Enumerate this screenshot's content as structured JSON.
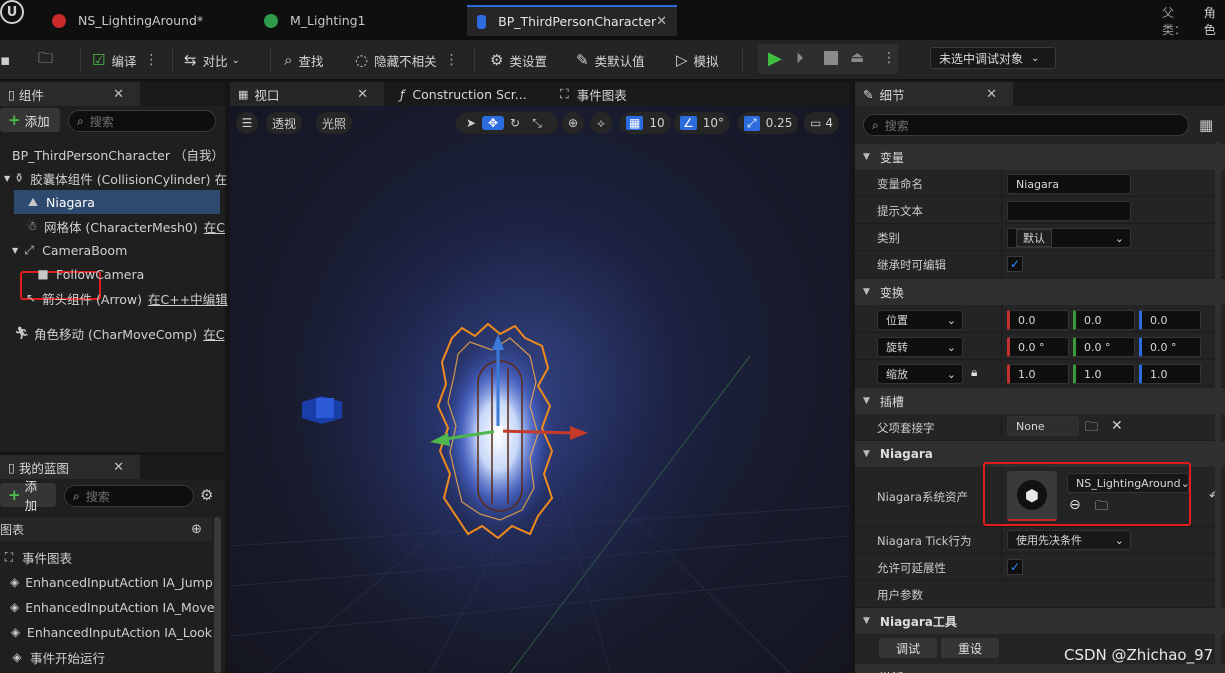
{
  "tabs": [
    {
      "label": "NS_LightingAround*",
      "icon": "niagara-system-icon"
    },
    {
      "label": "M_Lighting1",
      "icon": "material-icon"
    },
    {
      "label": "BP_ThirdPersonCharacter",
      "icon": "blueprint-character-icon"
    }
  ],
  "parent_class": {
    "label": "父类：",
    "value": "角色"
  },
  "toolbar": {
    "compile": "编译",
    "diff": "对比",
    "find": "查找",
    "hide_unrelated": "隐藏不相关",
    "class_settings": "类设置",
    "class_defaults": "类默认值",
    "simulate": "模拟",
    "debug_target": "未选中调试对象"
  },
  "components_panel": {
    "tab": "组件",
    "add": "添加",
    "search_placeholder": "搜索",
    "items": [
      {
        "label": "BP_ThirdPersonCharacter （自我）"
      },
      {
        "label": "胶囊体组件 (CollisionCylinder)",
        "suffix": "在"
      },
      {
        "label": "Niagara"
      },
      {
        "label": "网格体 (CharacterMesh0)",
        "suffix": "在C"
      },
      {
        "label": "CameraBoom"
      },
      {
        "label": "FollowCamera"
      },
      {
        "label": "箭头组件 (Arrow)",
        "suffix": "在C++中编辑"
      },
      {
        "label": "角色移动 (CharMoveComp)",
        "suffix": "在C"
      }
    ]
  },
  "blueprint_panel": {
    "tab": "我的蓝图",
    "add": "添加",
    "search_placeholder": "搜索",
    "graphs_header": "图表",
    "items": [
      {
        "label": "事件图表"
      },
      {
        "label": "EnhancedInputAction IA_Jump"
      },
      {
        "label": "EnhancedInputAction IA_Move"
      },
      {
        "label": "EnhancedInputAction IA_Look"
      },
      {
        "label": "事件开始运行"
      }
    ]
  },
  "center_tabs": {
    "viewport": "视口",
    "construction": "Construction Scr...",
    "event_graph": "事件图表"
  },
  "viewport": {
    "perspective": "透视",
    "lit": "光照",
    "grid_snap": "10",
    "rot_snap": "10°",
    "scale_snap": "0.25",
    "camera_speed": "4"
  },
  "details": {
    "tab": "细节",
    "search_placeholder": "搜索",
    "sections": {
      "variable": "变量",
      "transform": "变换",
      "sockets": "插槽",
      "niagara": "Niagara",
      "niagara_tools": "Niagara工具",
      "activation": "激活"
    },
    "variable": {
      "name_label": "变量命名",
      "name_value": "Niagara",
      "tooltip_label": "提示文本",
      "tooltip_value": "",
      "category_label": "类别",
      "category_value": "默认",
      "editable_label": "继承时可编辑"
    },
    "transform": {
      "location_label": "位置",
      "location": [
        "0.0",
        "0.0",
        "0.0"
      ],
      "rotation_label": "旋转",
      "rotation": [
        "0.0 °",
        "0.0 °",
        "0.0 °"
      ],
      "scale_label": "缩放",
      "scale": [
        "1.0",
        "1.0",
        "1.0"
      ]
    },
    "sockets": {
      "parent_label": "父项套接字",
      "parent_value": "None"
    },
    "niagara": {
      "asset_label": "Niagara系统资产",
      "asset_value": "NS_LightingAround",
      "tick_label": "Niagara Tick行为",
      "tick_value": "使用先决条件",
      "scalability_label": "允许可延展性",
      "user_params_label": "用户参数"
    },
    "tools": {
      "debug": "调试",
      "reset": "重设"
    }
  },
  "watermark": "CSDN @Zhichao_97",
  "colors": {
    "accent": "#2d6cdf",
    "highlight_box": "#e01c1c",
    "play_green": "#3fbf3f"
  }
}
